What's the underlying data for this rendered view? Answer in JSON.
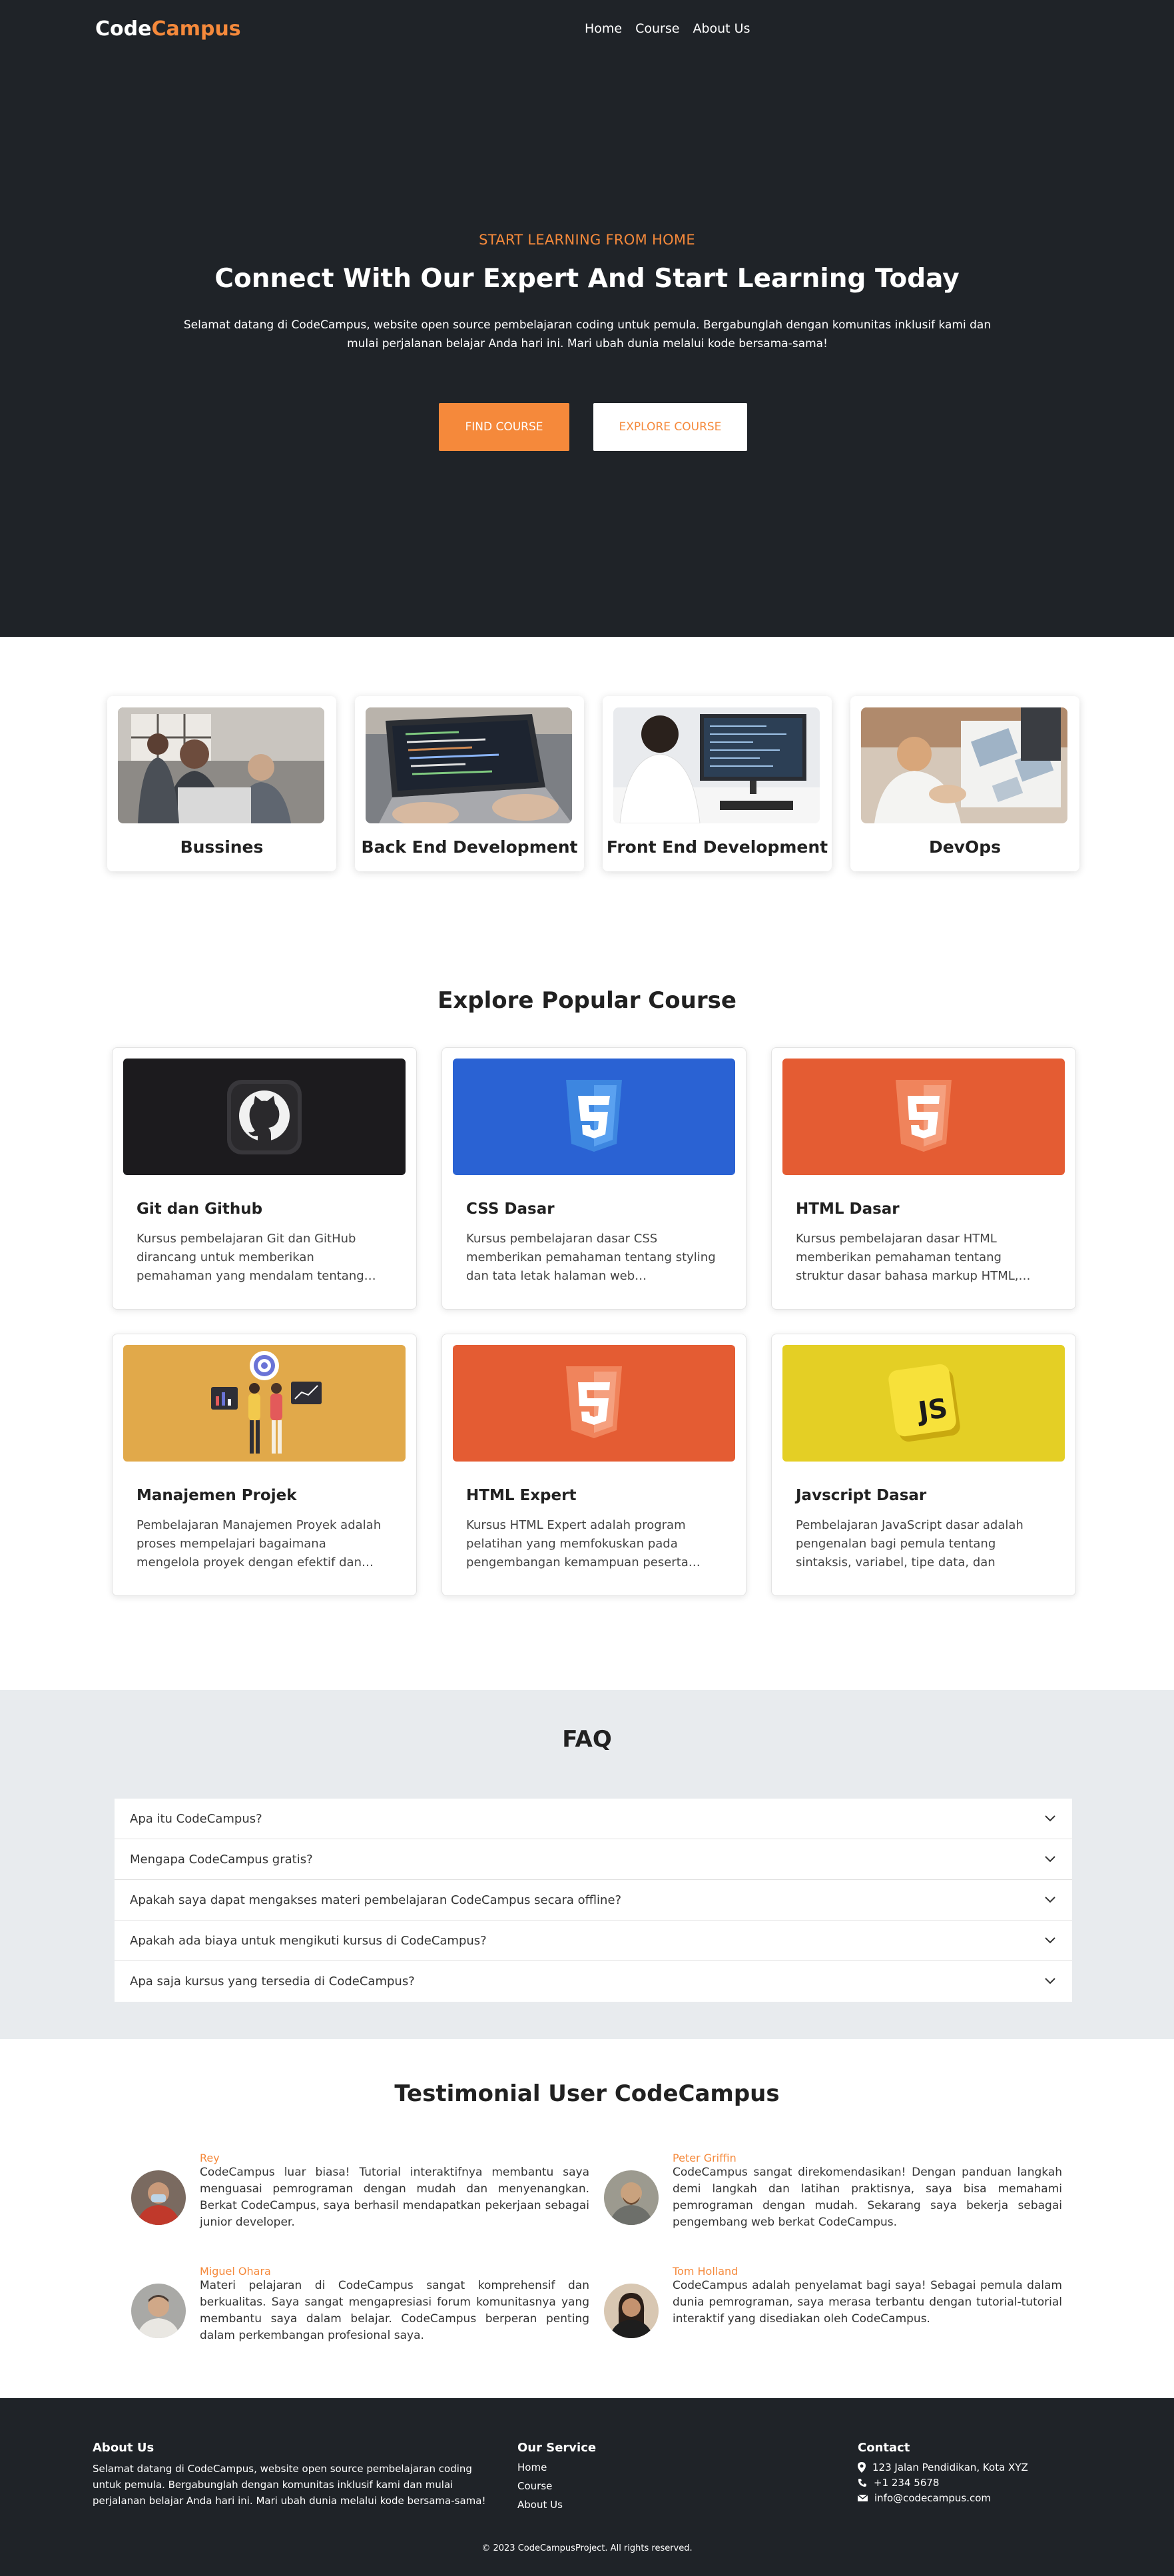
{
  "nav": {
    "brand_main": "Code",
    "brand_accent": "Campus",
    "links": [
      "Home",
      "Course",
      "About Us"
    ]
  },
  "hero": {
    "eyebrow": "START LEARNING FROM HOME",
    "title": "Connect With Our Expert And Start Learning Today",
    "description": "Selamat datang di CodeCampus, website open source pembelajaran coding untuk pemula. Bergabunglah dengan komunitas inklusif kami dan mulai perjalanan belajar Anda hari ini. Mari ubah dunia melalui kode bersama-sama!",
    "find_button": "FIND COURSE",
    "explore_button": "EXPLORE COURSE"
  },
  "categories": [
    {
      "label": "Bussines"
    },
    {
      "label": "Back End Development"
    },
    {
      "label": "Front End Development"
    },
    {
      "label": "DevOps"
    }
  ],
  "popular": {
    "title": "Explore Popular Course",
    "courses": [
      {
        "title": "Git dan Github",
        "desc": "Kursus pembelajaran Git dan GitHub dirancang untuk memberikan pemahaman yang mendalam tentang…",
        "icon": "github-icon",
        "color": "#1c1b1e"
      },
      {
        "title": "CSS Dasar",
        "desc": "Kursus pembelajaran dasar CSS memberikan pemahaman tentang styling dan tata letak halaman web…",
        "icon": "css3-icon",
        "color": "#2a62d3"
      },
      {
        "title": "HTML Dasar",
        "desc": "Kursus pembelajaran dasar HTML memberikan pemahaman tentang struktur dasar bahasa markup HTML,…",
        "icon": "html5-icon",
        "color": "#e45c33"
      },
      {
        "title": "Manajemen Projek",
        "desc": "Pembelajaran Manajemen Proyek adalah proses mempelajari bagaimana mengelola proyek dengan efektif dan…",
        "icon": "project-management-icon",
        "color": "#e1a94a"
      },
      {
        "title": "HTML Expert",
        "desc": "Kursus HTML Expert adalah program pelatihan yang memfokuskan pada pengembangan kemampuan peserta…",
        "icon": "html5-icon",
        "color": "#e45c33"
      },
      {
        "title": "Javscript Dasar",
        "desc": "Pembelajaran JavaScript dasar adalah pengenalan bagi pemula tentang sintaksis, variabel, tipe data, dan struktu…",
        "icon": "javascript-icon",
        "color": "#e4cf25"
      }
    ]
  },
  "faq": {
    "title": "FAQ",
    "items": [
      "Apa itu CodeCampus?",
      "Mengapa CodeCampus gratis?",
      "Apakah saya dapat mengakses materi pembelajaran CodeCampus secara offline?",
      "Apakah ada biaya untuk mengikuti kursus di CodeCampus?",
      "Apa saja kursus yang tersedia di CodeCampus?"
    ]
  },
  "testimonials": {
    "title": "Testimonial User CodeCampus",
    "items": [
      {
        "name": "Rey",
        "text": "CodeCampus luar biasa! Tutorial interaktifnya membantu saya menguasai pemrograman dengan mudah dan menyenangkan. Berkat CodeCampus, saya berhasil mendapatkan pekerjaan sebagai junior developer."
      },
      {
        "name": "Peter Griffin",
        "text": "CodeCampus sangat direkomendasikan! Dengan panduan langkah demi langkah dan latihan praktisnya, saya bisa memahami pemrograman dengan mudah. Sekarang saya bekerja sebagai pengembang web berkat CodeCampus."
      },
      {
        "name": "Miguel Ohara",
        "text": "Materi pelajaran di CodeCampus sangat komprehensif dan berkualitas. Saya sangat mengapresiasi forum komunitasnya yang membantu saya dalam belajar. CodeCampus berperan penting dalam perkembangan profesional saya."
      },
      {
        "name": "Tom Holland",
        "text": "CodeCampus adalah penyelamat bagi saya! Sebagai pemula dalam dunia pemrograman, saya merasa terbantu dengan tutorial-tutorial interaktif yang disediakan oleh CodeCampus."
      }
    ]
  },
  "footer": {
    "about_title": "About Us",
    "about_text": "Selamat datang di CodeCampus, website open source pembelajaran coding untuk pemula. Bergabunglah dengan komunitas inklusif kami dan mulai perjalanan belajar Anda hari ini. Mari ubah dunia melalui kode bersama-sama!",
    "service_title": "Our Service",
    "service_links": [
      "Home",
      "Course",
      "About Us"
    ],
    "contact_title": "Contact",
    "address": "123 Jalan Pendidikan, Kota XYZ",
    "phone": "+1 234 5678",
    "email": "info@codecampus.com",
    "copyright": "© 2023 CodeCampusProject. All rights reserved."
  },
  "colors": {
    "accent": "#f5893b",
    "dark": "#1f2328",
    "faq_bg": "#e8ebee"
  }
}
